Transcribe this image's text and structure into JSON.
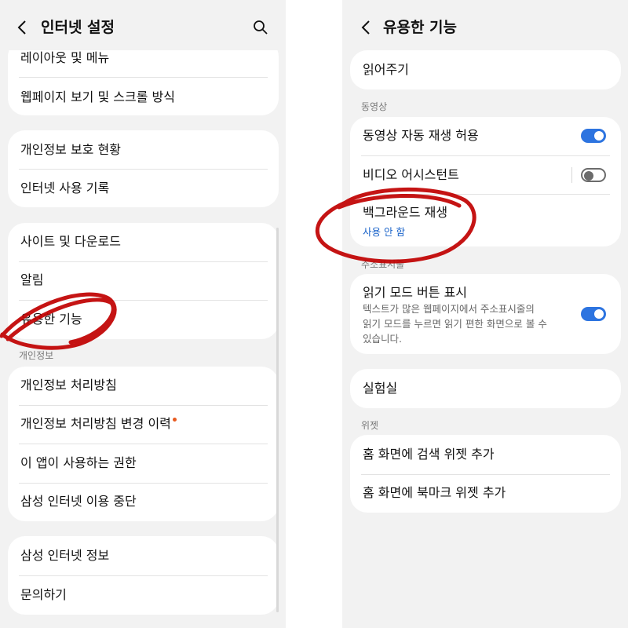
{
  "left": {
    "header": {
      "title": "인터넷 설정",
      "back_icon": "chevron-left-icon",
      "search_icon": "search-icon"
    },
    "group1": [
      "레이아웃 및 메뉴",
      "웹페이지 보기 및 스크롤 방식"
    ],
    "group2": [
      "개인정보 보호 현황",
      "인터넷 사용 기록"
    ],
    "group3": [
      "사이트 및 다운로드",
      "알림",
      "유용한 기능"
    ],
    "section_privacy": "개인정보",
    "group4": [
      "개인정보 처리방침",
      "개인정보 처리방침 변경 이력",
      "이 앱이 사용하는 권한",
      "삼성 인터넷 이용 중단"
    ],
    "group5": [
      "삼성 인터넷 정보",
      "문의하기"
    ]
  },
  "right": {
    "header": {
      "title": "유용한 기능",
      "back_icon": "chevron-left-icon"
    },
    "read_aloud": "읽어주기",
    "section_video": "동영상",
    "video_autoplay": {
      "label": "동영상 자동 재생 허용",
      "enabled": true
    },
    "video_assistant": {
      "label": "비디오 어시스턴트",
      "enabled": false
    },
    "background_play": {
      "label": "백그라운드 재생",
      "value": "사용 안 함"
    },
    "section_address_bar": "주소표시줄",
    "reader_mode": {
      "label": "읽기 모드 버튼 표시",
      "desc_lines": [
        "텍스트가 많은 웹페이지에서 주소표시줄의",
        "읽기 모드를 누르면 읽기 편한 화면으로 볼 수",
        "있습니다."
      ],
      "enabled": true
    },
    "labs": "실험실",
    "section_widget": "위젯",
    "widgets": [
      "홈 화면에 검색 위젯 추가",
      "홈 화면에 북마크 위젯 추가"
    ]
  },
  "colors": {
    "toggle_on": "#2d74e0",
    "link": "#1a63c9",
    "badge_dot": "#e85a1f",
    "annotation_circle": "#c00000"
  }
}
